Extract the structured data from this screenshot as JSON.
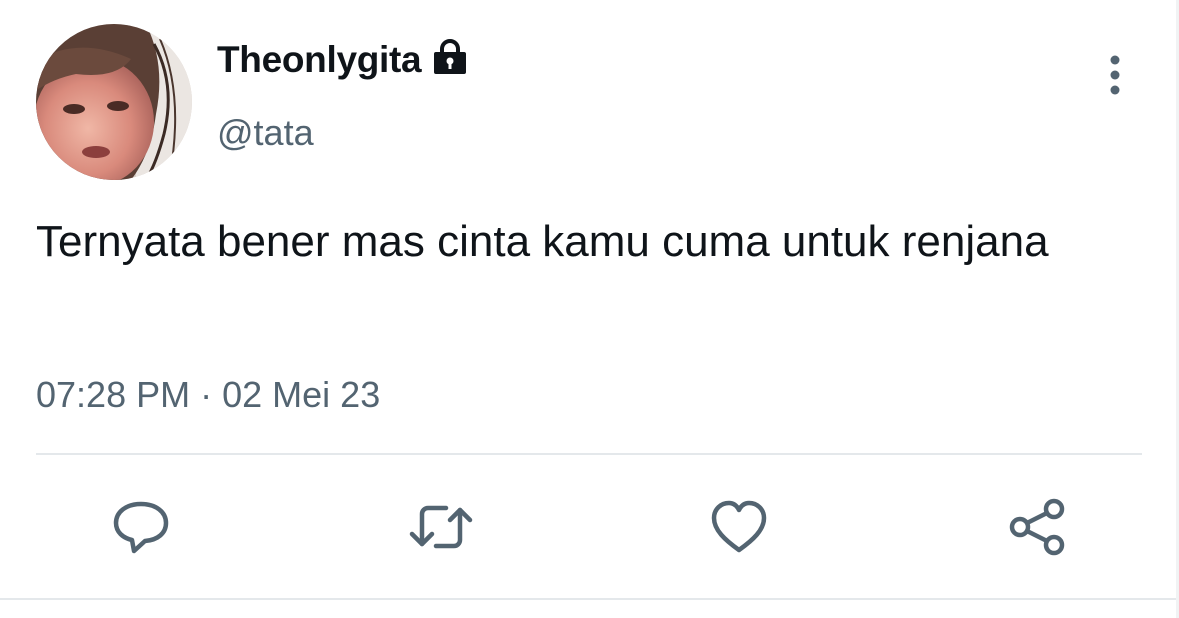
{
  "user": {
    "display_name": "Theonlygita",
    "handle": "@tata",
    "protected": true
  },
  "tweet": {
    "text": "Ternyata bener mas cinta kamu cuma untuk renjana",
    "time": "07:28 PM",
    "separator": "·",
    "date": "02 Mei 23"
  },
  "icons": {
    "lock": "lock-icon",
    "more": "more-vertical-icon",
    "reply": "reply-icon",
    "retweet": "retweet-icon",
    "like": "heart-icon",
    "share": "share-icon"
  },
  "colors": {
    "text": "#0f1419",
    "secondary": "#536471",
    "icon": "#536471",
    "divider": "#e4e8eb"
  }
}
